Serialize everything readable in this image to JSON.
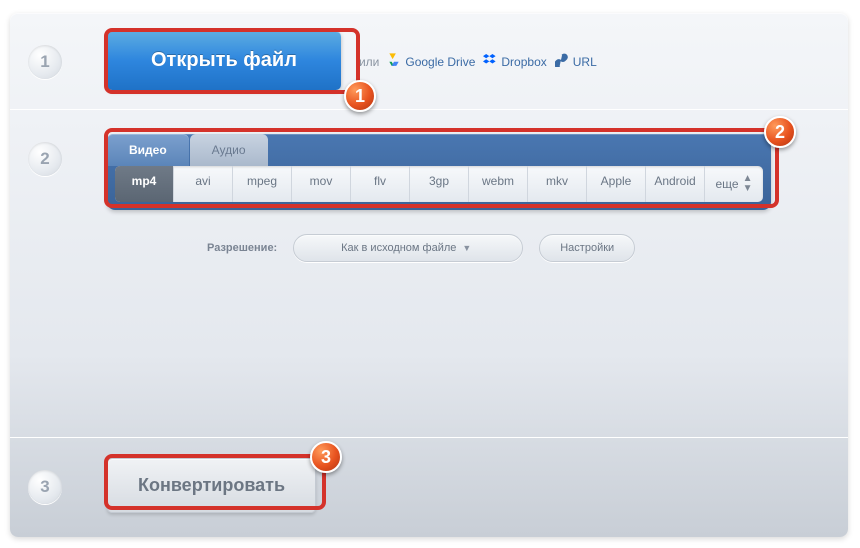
{
  "steps": {
    "s1": "1",
    "s2": "2",
    "s3": "3"
  },
  "open": {
    "button": "Открыть файл",
    "or": "или",
    "gdrive": "Google Drive",
    "dropbox": "Dropbox",
    "url": "URL"
  },
  "tabs": {
    "video": "Видео",
    "audio": "Аудио"
  },
  "formats": [
    "mp4",
    "avi",
    "mpeg",
    "mov",
    "flv",
    "3gp",
    "webm",
    "mkv",
    "Apple",
    "Android",
    "еще"
  ],
  "resolution": {
    "label": "Разрешение:",
    "value": "Как в исходном файле",
    "settings": "Настройки"
  },
  "convert": {
    "button": "Конвертировать"
  },
  "annotations": {
    "a1": "1",
    "a2": "2",
    "a3": "3"
  }
}
